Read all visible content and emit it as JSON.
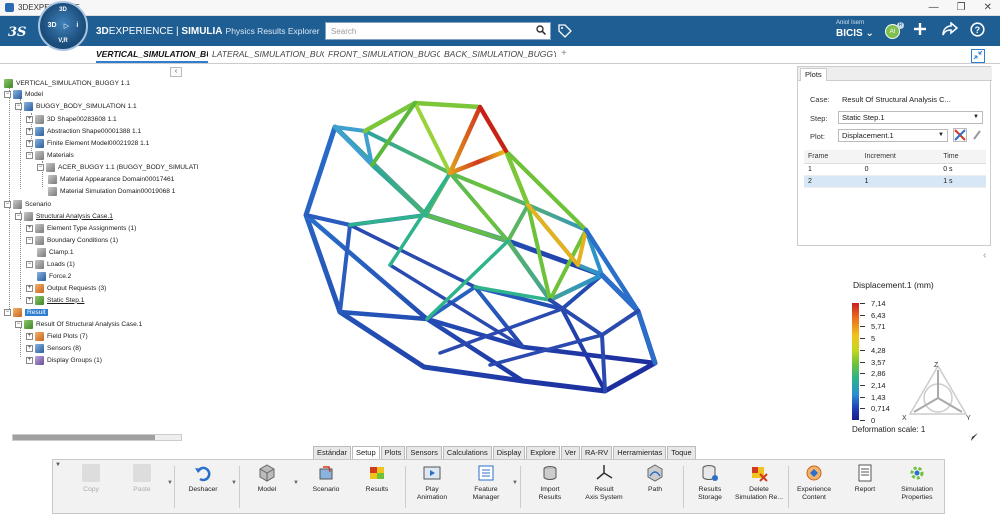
{
  "window": {
    "title": "3DEXPERIENCE",
    "min": "—",
    "max": "❐",
    "close": "✕"
  },
  "compass": {
    "top": "3D",
    "left": "3D",
    "right": "i",
    "bottom": "V,R",
    "play": "▷"
  },
  "brand": {
    "prefix": "3D",
    "experience": "EXPERIENCE",
    "sep": " | ",
    "simulia": "SIMULIA",
    "app": "Physics Results Explorer"
  },
  "search": {
    "placeholder": "Search",
    "icon": "search-icon"
  },
  "user": {
    "name": "Aniol Isern",
    "org": "BICIS",
    "chevron": "⌄",
    "initials": "AI",
    "badge": "R"
  },
  "tabs": [
    {
      "label": "VERTICAL_SIMULATION_BU"
    },
    {
      "label": "LATERAL_SIMULATION_BUGG"
    },
    {
      "label": "FRONT_SIMULATION_BUGG"
    },
    {
      "label": "BACK_SIMULATION_BUGGY"
    }
  ],
  "add_tab": "+",
  "tree": {
    "collapse": "‹",
    "root": "VERTICAL_SIMULATION_BUGGY 1.1",
    "model": "Model",
    "buggy_body": "BUGGY_BODY_SIMULATION 1.1",
    "shape": "3D Shape00283608 1.1",
    "abstraction": "Abstraction Shape00001388 1.1",
    "fem": "Finite Element Model00021928 1.1",
    "materials": "Materials",
    "acer": "ACER_BUGGY 1.1 (BUGGY_BODY_SIMULATI",
    "mat_app": "Material Appearance Domain00017461",
    "mat_sim": "Material Simulation Domain00019068 1",
    "scenario": "Scenario",
    "sac": "Structural Analysis Case.1",
    "eta": "Element Type Assignments (1)",
    "bc": "Boundary Conditions (1)",
    "clamp": "Clamp.1",
    "loads": "Loads (1)",
    "force": "Force.2",
    "output": "Output Requests (3)",
    "step": "Static Step.1",
    "result": "Result",
    "ros": "Result Of Structural Analysis Case.1",
    "field": "Field Plots (7)",
    "sensors": "Sensors (8)",
    "display": "Display Groups (1)"
  },
  "plots": {
    "tab": "Plots",
    "case_label": "Case:",
    "case_value": "Result Of Structural Analysis C...",
    "step_label": "Step:",
    "step_value": "Static Step.1",
    "plot_label": "Plot:",
    "plot_value": "Displacement.1",
    "columns": [
      "Frame",
      "Increment",
      "Time"
    ],
    "rows": [
      {
        "frame": "1",
        "increment": "0",
        "time": "0 s"
      },
      {
        "frame": "2",
        "increment": "1",
        "time": "1 s"
      }
    ]
  },
  "legend": {
    "title": "Displacement.1 (mm)",
    "values": [
      "7,14",
      "6,43",
      "5,71",
      "5",
      "4,28",
      "3,57",
      "2,86",
      "2,14",
      "1,43",
      "0,714",
      "0"
    ],
    "deformation": "Deformation scale: 1",
    "axes": {
      "z": "Z",
      "x": "X",
      "y": "Y"
    }
  },
  "toolbar_tabs": [
    "Estándar",
    "Setup",
    "Plots",
    "Sensors",
    "Calculations",
    "Display",
    "Explore",
    "Ver",
    "RA-RV",
    "Herramientas",
    "Toque"
  ],
  "toolbar_active": "Setup",
  "tools": {
    "copy": "Copy",
    "paste": "Paste",
    "undo": "Deshacer",
    "model": "Model",
    "scenario": "Scenario",
    "results": "Results",
    "play1": "Play",
    "play2": "Animation",
    "fm1": "Feature",
    "fm2": "Manager",
    "ir1": "Import",
    "ir2": "Results",
    "ra1": "Result",
    "ra2": "Axis System",
    "path": "Path",
    "rs1": "Results",
    "rs2": "Storage",
    "del1": "Delete",
    "del2": "Simulation Re...",
    "exp1": "Experience",
    "exp2": "Content",
    "report": "Report",
    "sp1": "Simulation",
    "sp2": "Properties"
  }
}
